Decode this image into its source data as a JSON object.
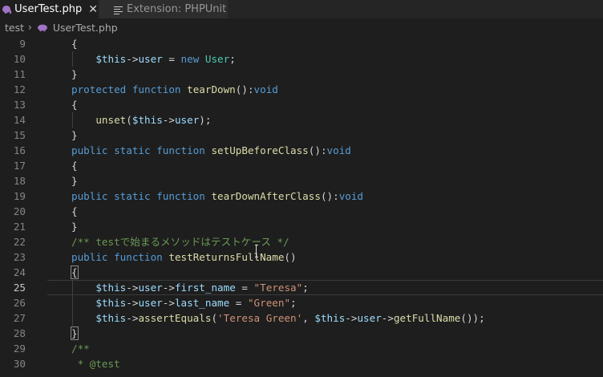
{
  "tabs": [
    {
      "label": "UserTest.php",
      "icon": "php-elephant-icon",
      "active": true,
      "close": "✕"
    },
    {
      "label": "Extension: PHPUnit",
      "icon": "extension-doc-icon",
      "active": false
    }
  ],
  "breadcrumb": {
    "folder": "test",
    "separator": "›",
    "file": "UserTest.php"
  },
  "colors": {
    "keyword": "#569cd6",
    "function": "#dcdcaa",
    "class": "#4ec9b0",
    "property": "#9cdcfe",
    "string": "#ce9178",
    "comment": "#6a9955"
  },
  "editor": {
    "cursor_line": 25,
    "lines": [
      {
        "n": "9",
        "segs": [
          [
            "pl",
            "{"
          ]
        ]
      },
      {
        "n": "10",
        "segs": [
          [
            "pl",
            "    "
          ],
          [
            "prop",
            "$this"
          ],
          [
            "pl",
            "->"
          ],
          [
            "prop",
            "user"
          ],
          [
            "pl",
            " = "
          ],
          [
            "kw",
            "new"
          ],
          [
            "pl",
            " "
          ],
          [
            "cls",
            "User"
          ],
          [
            "pl",
            ";"
          ]
        ]
      },
      {
        "n": "11",
        "segs": [
          [
            "pl",
            "}"
          ]
        ]
      },
      {
        "n": "12",
        "segs": [
          [
            "kw",
            "protected"
          ],
          [
            "pl",
            " "
          ],
          [
            "kw",
            "function"
          ],
          [
            "pl",
            " "
          ],
          [
            "fn",
            "tearDown"
          ],
          [
            "pl",
            "():"
          ],
          [
            "kw",
            "void"
          ]
        ]
      },
      {
        "n": "13",
        "segs": [
          [
            "pl",
            "{"
          ]
        ]
      },
      {
        "n": "14",
        "segs": [
          [
            "pl",
            "    "
          ],
          [
            "fn",
            "unset"
          ],
          [
            "pl",
            "("
          ],
          [
            "prop",
            "$this"
          ],
          [
            "pl",
            "->"
          ],
          [
            "prop",
            "user"
          ],
          [
            "pl",
            ");"
          ]
        ]
      },
      {
        "n": "15",
        "segs": [
          [
            "pl",
            "}"
          ]
        ]
      },
      {
        "n": "16",
        "segs": [
          [
            "kw",
            "public"
          ],
          [
            "pl",
            " "
          ],
          [
            "kw",
            "static"
          ],
          [
            "pl",
            " "
          ],
          [
            "kw",
            "function"
          ],
          [
            "pl",
            " "
          ],
          [
            "fn",
            "setUpBeforeClass"
          ],
          [
            "pl",
            "():"
          ],
          [
            "kw",
            "void"
          ]
        ]
      },
      {
        "n": "17",
        "segs": [
          [
            "pl",
            "{"
          ]
        ]
      },
      {
        "n": "18",
        "segs": [
          [
            "pl",
            "}"
          ]
        ]
      },
      {
        "n": "19",
        "segs": [
          [
            "kw",
            "public"
          ],
          [
            "pl",
            " "
          ],
          [
            "kw",
            "static"
          ],
          [
            "pl",
            " "
          ],
          [
            "kw",
            "function"
          ],
          [
            "pl",
            " "
          ],
          [
            "fn",
            "tearDownAfterClass"
          ],
          [
            "pl",
            "():"
          ],
          [
            "kw",
            "void"
          ]
        ]
      },
      {
        "n": "20",
        "segs": [
          [
            "pl",
            "{"
          ]
        ]
      },
      {
        "n": "21",
        "segs": [
          [
            "pl",
            "}"
          ]
        ]
      },
      {
        "n": "22",
        "segs": [
          [
            "cmt",
            "/** testで始まるメソッドはテストケース */"
          ]
        ]
      },
      {
        "n": "23",
        "segs": [
          [
            "kw",
            "public"
          ],
          [
            "pl",
            " "
          ],
          [
            "kw",
            "function"
          ],
          [
            "pl",
            " "
          ],
          [
            "fn",
            "testReturnsFullName"
          ],
          [
            "pl",
            "()"
          ]
        ]
      },
      {
        "n": "24",
        "segs": [
          [
            "pl",
            "{"
          ]
        ]
      },
      {
        "n": "25",
        "segs": [
          [
            "pl",
            "    "
          ],
          [
            "prop",
            "$this"
          ],
          [
            "pl",
            "->"
          ],
          [
            "prop",
            "user"
          ],
          [
            "pl",
            "->"
          ],
          [
            "prop",
            "first_name"
          ],
          [
            "pl",
            " = "
          ],
          [
            "str",
            "\"Teresa\""
          ],
          [
            "pl",
            ";"
          ]
        ]
      },
      {
        "n": "26",
        "segs": [
          [
            "pl",
            "    "
          ],
          [
            "prop",
            "$this"
          ],
          [
            "pl",
            "->"
          ],
          [
            "prop",
            "user"
          ],
          [
            "pl",
            "->"
          ],
          [
            "prop",
            "last_name"
          ],
          [
            "pl",
            " = "
          ],
          [
            "str",
            "\"Green\""
          ],
          [
            "pl",
            ";"
          ]
        ]
      },
      {
        "n": "27",
        "segs": [
          [
            "pl",
            "    "
          ],
          [
            "prop",
            "$this"
          ],
          [
            "pl",
            "->"
          ],
          [
            "fn",
            "assertEquals"
          ],
          [
            "pl",
            "("
          ],
          [
            "str",
            "'Teresa Green'"
          ],
          [
            "pl",
            ", "
          ],
          [
            "prop",
            "$this"
          ],
          [
            "pl",
            "->"
          ],
          [
            "prop",
            "user"
          ],
          [
            "pl",
            "->"
          ],
          [
            "fn",
            "getFullName"
          ],
          [
            "pl",
            "());"
          ]
        ]
      },
      {
        "n": "28",
        "segs": [
          [
            "pl",
            "}"
          ]
        ]
      },
      {
        "n": "29",
        "segs": [
          [
            "cmt",
            "/**"
          ]
        ]
      },
      {
        "n": "30",
        "segs": [
          [
            "cmt",
            " * @test"
          ]
        ]
      }
    ]
  }
}
